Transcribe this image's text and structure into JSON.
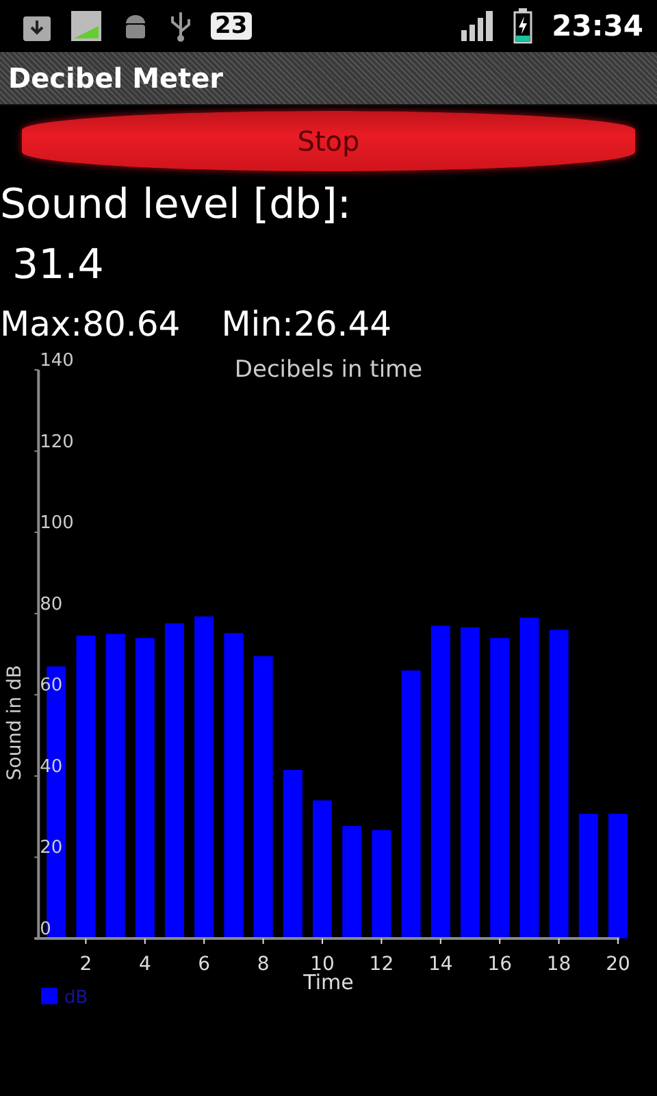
{
  "status_bar": {
    "notification_count": "23",
    "time": "23:34",
    "battery_charging": true
  },
  "window": {
    "title": "Decibel Meter"
  },
  "stop_button": {
    "label": "Stop"
  },
  "sound_level": {
    "label": "Sound level [db]:",
    "value": "31.4"
  },
  "stats": {
    "max": "Max:80.64",
    "min": "Min:26.44"
  },
  "chart": {
    "chart_data": {
      "type": "bar",
      "title": "Decibels in time",
      "xlabel": "Time",
      "ylabel": "Sound in dB",
      "x": [
        1,
        2,
        3,
        4,
        5,
        6,
        7,
        8,
        9,
        10,
        11,
        12,
        13,
        14,
        15,
        16,
        17,
        18,
        19,
        20
      ],
      "series": [
        {
          "name": "dB",
          "color": "#0000ff",
          "values": [
            67,
            74.6,
            75,
            74,
            77.6,
            79.3,
            75.2,
            69.5,
            41.5,
            34,
            27.7,
            26.7,
            66,
            77,
            76.6,
            74,
            79,
            76,
            30.7,
            30.7
          ]
        }
      ],
      "xlim": [
        0.4,
        20
      ],
      "ylim": [
        0,
        140
      ],
      "xticks": [
        2,
        4,
        6,
        8,
        10,
        12,
        14,
        16,
        18,
        20
      ],
      "yticks": [
        0,
        20,
        40,
        60,
        80,
        100,
        120,
        140
      ]
    }
  }
}
